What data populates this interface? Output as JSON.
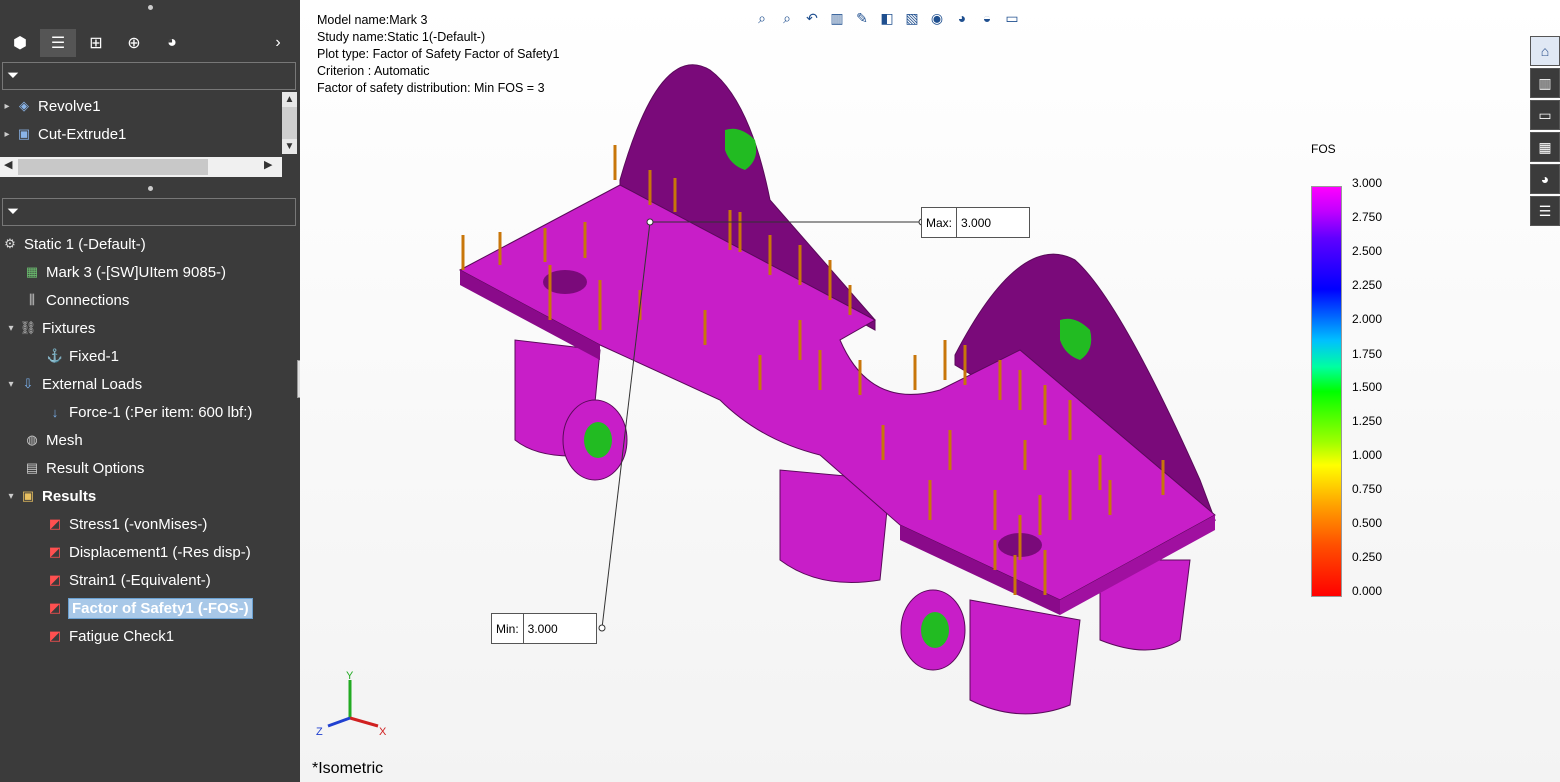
{
  "manager_tabs": [
    "feature-manager",
    "property-manager",
    "configuration-manager",
    "dimxpert-manager",
    "display-manager"
  ],
  "tree_top": [
    {
      "label": "Revolve1",
      "arrow": "▸"
    },
    {
      "label": "Cut-Extrude1",
      "arrow": "▸"
    }
  ],
  "sim_tree": {
    "study": "Static 1 (-Default-)",
    "part": "Mark 3 (-[SW]UItem 9085-)",
    "connections": "Connections",
    "fixtures": "Fixtures",
    "fixed": "Fixed-1",
    "external_loads": "External Loads",
    "force": "Force-1 (:Per item: 600 lbf:)",
    "mesh": "Mesh",
    "result_options": "Result Options",
    "results": "Results",
    "stress": "Stress1 (-vonMises-)",
    "displacement": "Displacement1 (-Res disp-)",
    "strain": "Strain1 (-Equivalent-)",
    "fos": "Factor of Safety1 (-FOS-)",
    "fatigue": "Fatigue Check1"
  },
  "info": {
    "line1": "Model name:Mark 3",
    "line2": "Study name:Static 1(-Default-)",
    "line3": "Plot type: Factor of Safety Factor of Safety1",
    "line4": "Criterion : Automatic",
    "line5": "Factor of safety distribution: Min FOS = 3"
  },
  "legend": {
    "title": "FOS",
    "ticks": [
      "3.000",
      "2.750",
      "2.500",
      "2.250",
      "2.000",
      "1.750",
      "1.500",
      "1.250",
      "1.000",
      "0.750",
      "0.500",
      "0.250",
      "0.000"
    ],
    "colors": {
      "max": "#ff00ff",
      "min": "#ff0000"
    }
  },
  "callouts": {
    "max_label": "Max:",
    "max_value": "3.000",
    "min_label": "Min:",
    "min_value": "3.000"
  },
  "triad": {
    "y": "Y",
    "x": "X",
    "z": "Z"
  },
  "view_name": "*Isometric",
  "colors": {
    "model": "#c81ec8",
    "model_dark": "#7a0a7a",
    "loads": "#c8760a"
  }
}
